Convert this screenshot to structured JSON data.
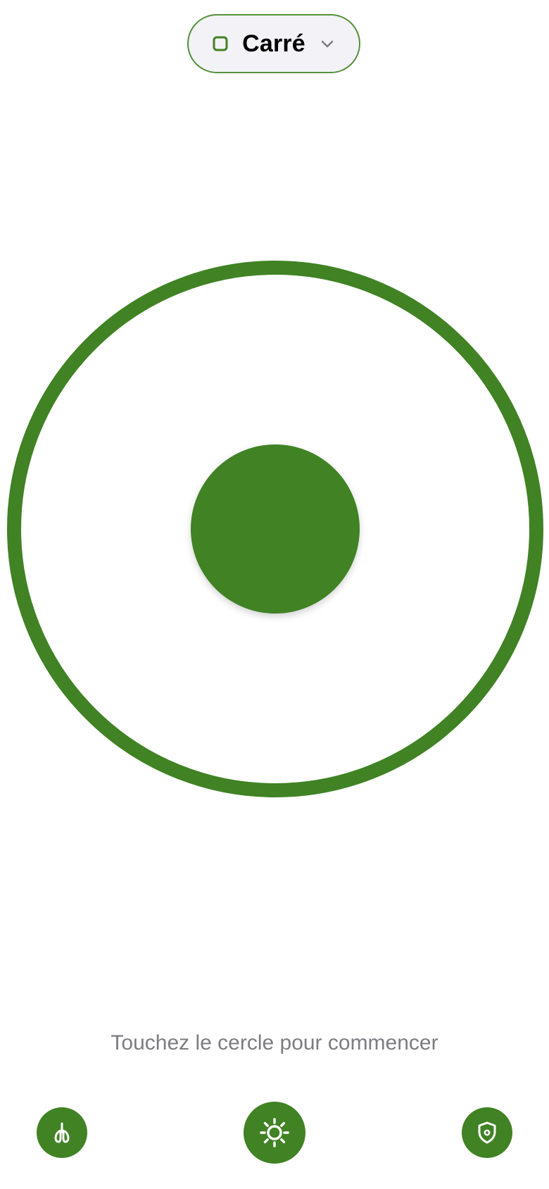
{
  "mode_selector": {
    "label": "Carré",
    "icon": "square-icon",
    "chevron_icon": "chevron-down-icon"
  },
  "breathing": {
    "outer_icon": "outer-circle",
    "inner_icon": "inner-circle"
  },
  "hint": "Touchez le cercle pour commencer",
  "bottom_bar": {
    "left_icon": "lungs-icon",
    "center_icon": "sun-icon",
    "right_icon": "shield-icon"
  },
  "colors": {
    "accent": "#408224",
    "selector_border": "#55913a",
    "selector_bg": "#f2f2f7",
    "hint_text": "#7c7c82"
  }
}
